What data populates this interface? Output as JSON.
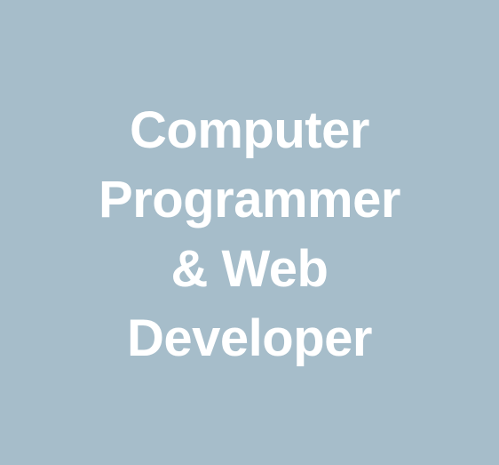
{
  "colors": {
    "background": "#a6bdca",
    "text": "#ffffff"
  },
  "title_lines": [
    "Computer",
    "Programmer",
    "& Web",
    "Developer"
  ]
}
